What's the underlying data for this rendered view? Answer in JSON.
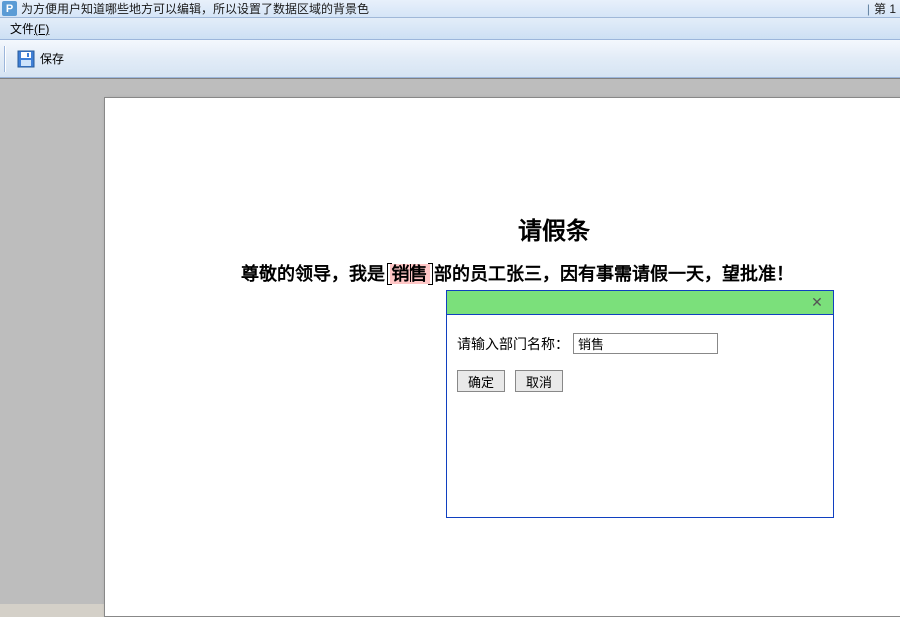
{
  "titlebar": {
    "app_initial": "P",
    "text": "为方便用户知道哪些地方可以编辑，所以设置了数据区域的背景色",
    "right_text": "第 1"
  },
  "menu": {
    "file_label": "文件",
    "file_accel": "(F)"
  },
  "toolbar": {
    "save_label": "保存"
  },
  "document": {
    "title": "请假条",
    "prefix": "尊敬的领导，我是 ",
    "editable_value": "销售",
    "middle": " 部的员工张三，因有事需请假一天，望批准！"
  },
  "dialog": {
    "field_label": "请输入部门名称：",
    "field_value": "销售",
    "ok_label": "确定",
    "cancel_label": "取消"
  }
}
